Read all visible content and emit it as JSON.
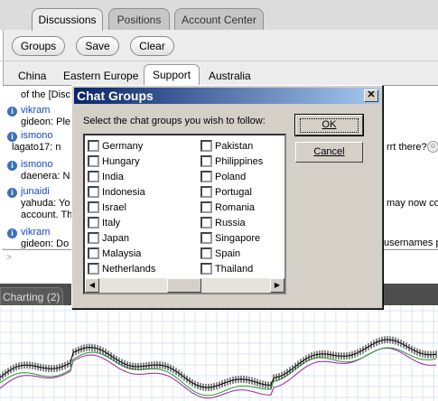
{
  "top_tabs": [
    {
      "label": "Discussions",
      "active": true
    },
    {
      "label": "Positions",
      "active": false
    },
    {
      "label": "Account Center",
      "active": false
    }
  ],
  "toolbar": {
    "groups_label": "Groups",
    "save_label": "Save",
    "clear_label": "Clear"
  },
  "region_tabs": [
    {
      "label": "China",
      "active": false
    },
    {
      "label": "Eastern Europe",
      "active": false
    },
    {
      "label": "Support",
      "active": true
    },
    {
      "label": "Australia",
      "active": false
    }
  ],
  "messages": {
    "first_line": "of the [Disc",
    "entries": [
      {
        "user": "vikram",
        "line1": "gideon: Ple",
        "line2": ""
      },
      {
        "user": "ismono",
        "line1": "lagato17: n",
        "line2": ""
      },
      {
        "user": "ismono",
        "line1": "daenera: N",
        "line2": ""
      },
      {
        "user": "junaidi",
        "line1": "yahuda: Yo",
        "line2": "account. Th"
      },
      {
        "user": "vikram",
        "line1": "gideon: Do",
        "line2": ""
      }
    ],
    "right_fragments": [
      "rrt there?",
      "may now co",
      "usernames pl"
    ]
  },
  "input": {
    "prompt": ">"
  },
  "charting": {
    "tab_label": "Charting (2)"
  },
  "dialog": {
    "title": "Chat Groups",
    "close_glyph": "✕",
    "prompt": "Select the chat groups you wish to follow:",
    "ok_label": "OK",
    "cancel_label": "Cancel",
    "groups_col1": [
      "Germany",
      "Hungary",
      "India",
      "Indonesia",
      "Israel",
      "Italy",
      "Japan",
      "Malaysia",
      "Netherlands"
    ],
    "groups_col2": [
      "Pakistan",
      "Philippines",
      "Poland",
      "Portugal",
      "Romania",
      "Russia",
      "Singapore",
      "Spain",
      "Thailand"
    ],
    "scroll_left_glyph": "◀",
    "scroll_right_glyph": "▶"
  },
  "colors": {
    "titlebar_start": "#0a246a",
    "titlebar_end": "#a6caf0",
    "link_blue": "#1846c8",
    "chart_bg": "#ffffff"
  }
}
